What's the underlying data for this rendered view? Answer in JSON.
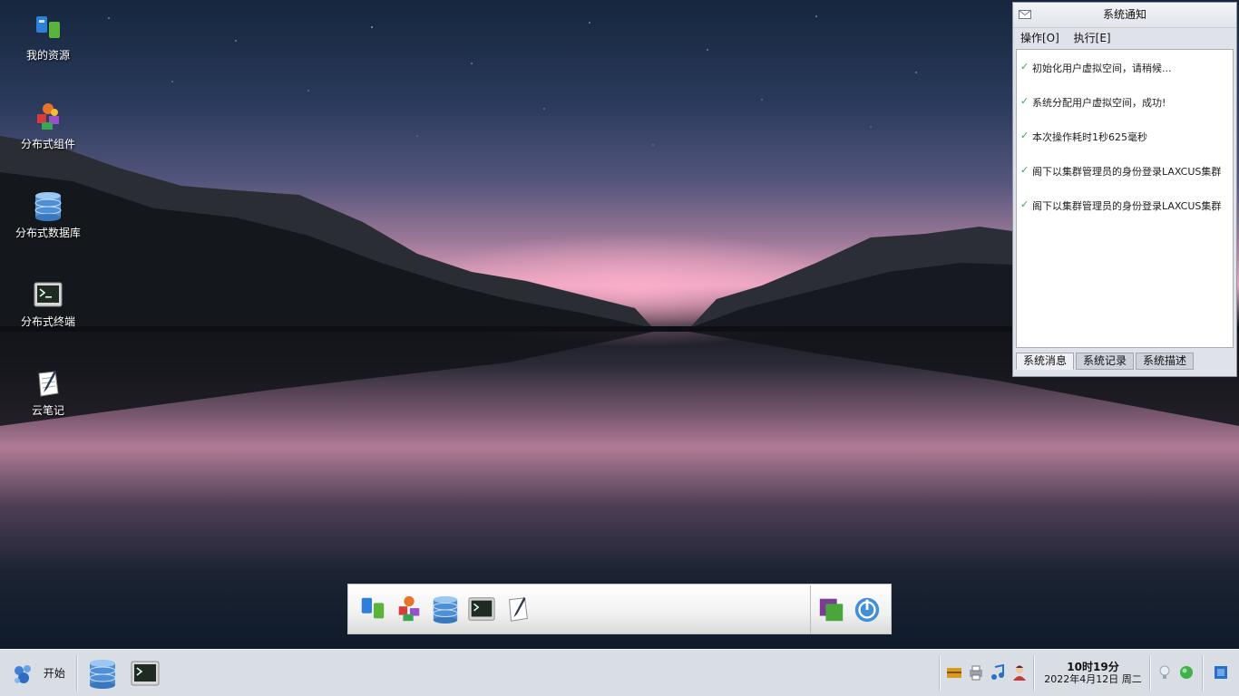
{
  "desktop": {
    "icons": [
      {
        "label": "我的资源",
        "icon": "my-resources-icon"
      },
      {
        "label": "分布式组件",
        "icon": "distributed-component-icon"
      },
      {
        "label": "分布式数据库",
        "icon": "distributed-database-icon"
      },
      {
        "label": "分布式终端",
        "icon": "distributed-terminal-icon"
      },
      {
        "label": "云笔记",
        "icon": "cloud-note-icon"
      }
    ]
  },
  "notification": {
    "title": "系统通知",
    "menu": [
      "操作[O]",
      "执行[E]"
    ],
    "messages": [
      "初始化用户虚拟空间，请稍候...",
      "系统分配用户虚拟空间，成功!",
      "本次操作耗时1秒625毫秒",
      "阁下以集群管理员的身份登录LAXCUS集群",
      "阁下以集群管理员的身份登录LAXCUS集群"
    ],
    "tabs": [
      "系统消息",
      "系统记录",
      "系统描述"
    ],
    "active_tab": "系统消息"
  },
  "dock": {
    "items": [
      "my-resources-icon",
      "distributed-component-icon",
      "distributed-database-icon",
      "distributed-terminal-icon",
      "cloud-note-icon"
    ],
    "right_items": [
      "switch-window-icon",
      "power-icon"
    ]
  },
  "taskbar": {
    "start_label": "开始",
    "tasks": [
      "distributed-database-icon",
      "distributed-terminal-icon"
    ],
    "tray": [
      "storage-icon",
      "printer-icon",
      "music-icon",
      "user-icon"
    ],
    "clock": {
      "time": "10时19分",
      "date": "2022年4月12日  周二"
    },
    "status": [
      "lightbulb-icon",
      "online-status-icon",
      "show-desktop-icon"
    ]
  },
  "colors": {
    "accent": "#3aa06a",
    "taskbar": "#d9dde4",
    "sky_pink": "#e5a3bd"
  }
}
